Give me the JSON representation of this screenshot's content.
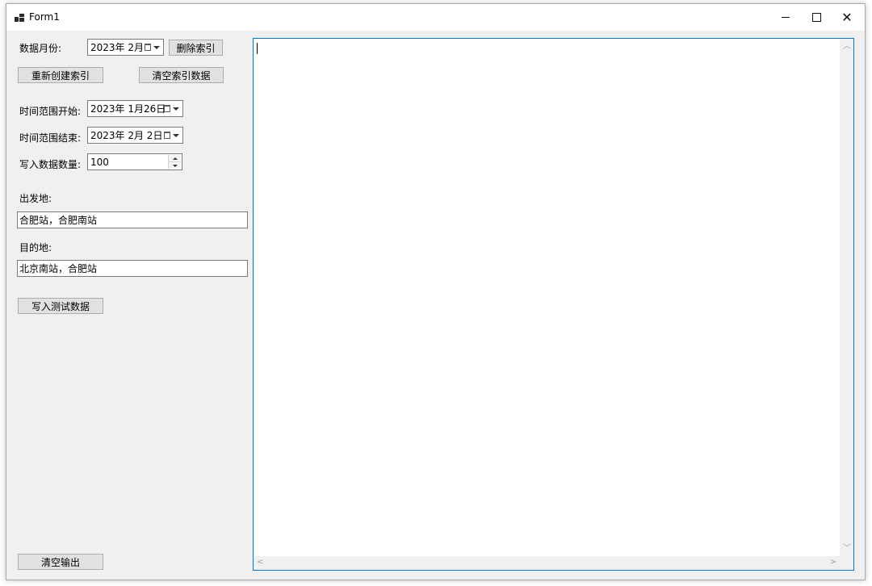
{
  "window": {
    "title": "Form1"
  },
  "form": {
    "data_month_label": "数据月份:",
    "data_month_value": "2023年  2月",
    "delete_index_button": "删除索引",
    "rebuild_index_button": "重新创建索引",
    "clear_index_button": "清空索引数据",
    "range_start_label": "时间范围开始:",
    "range_start_value": "2023年  1月26日",
    "range_end_label": "时间范围结束:",
    "range_end_value": "2023年  2月  2日",
    "write_count_label": "写入数据数量:",
    "write_count_value": "100",
    "departure_label": "出发地:",
    "departure_value": "合肥站，合肥南站",
    "destination_label": "目的地:",
    "destination_value": "北京南站，合肥站",
    "write_test_button": "写入测试数据",
    "clear_output_button": "清空输出"
  },
  "output": {
    "text": ""
  },
  "icons": {
    "app": "window-app-icon",
    "minimize": "minimize-icon",
    "maximize": "maximize-icon",
    "close": "close-icon",
    "calendar": "calendar-dropdown-icon",
    "spinner": "spinner-arrows-icon"
  },
  "colors": {
    "form_background": "#f0f0f0",
    "button_background": "#e1e1e1",
    "focus_border": "#0078d7"
  }
}
